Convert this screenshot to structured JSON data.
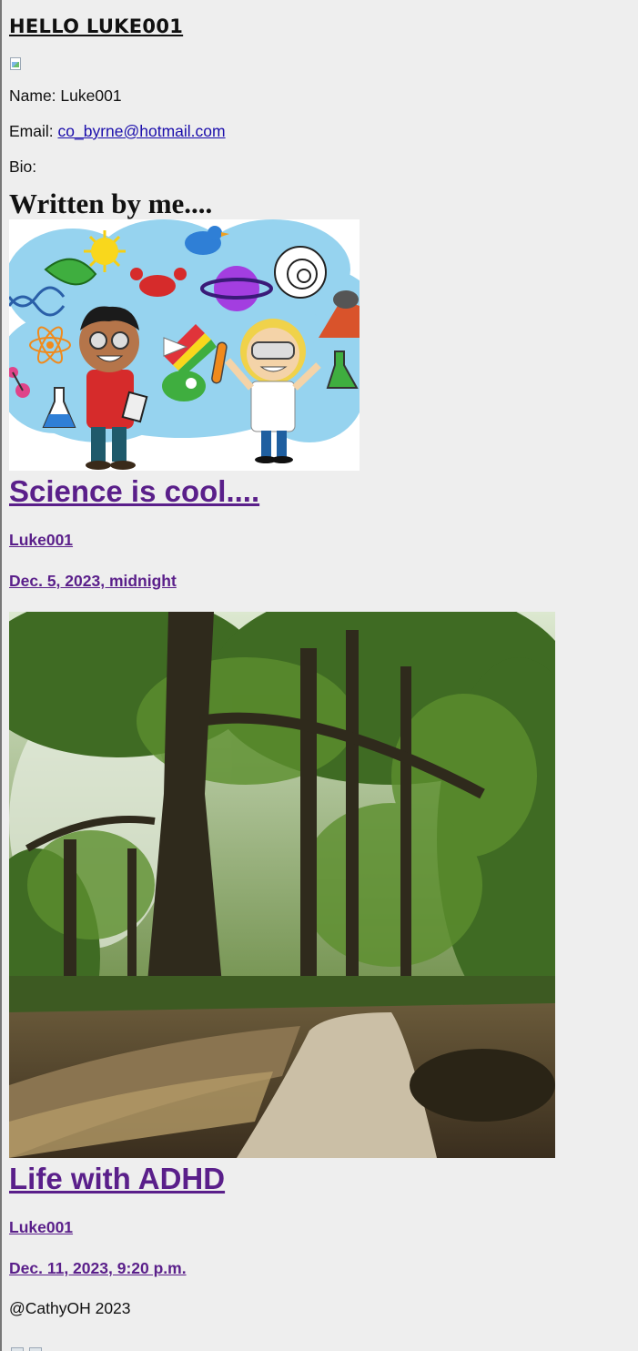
{
  "header": {
    "greeting": "HELLO LUKE001"
  },
  "profile": {
    "name_label": "Name:",
    "name_value": "Luke001",
    "email_label": "Email:",
    "email_value": "co_byrne@hotmail.com",
    "bio_label": "Bio:"
  },
  "section_title": "Written by me....",
  "posts": [
    {
      "image_icon": "science-illustration",
      "title": "Science is cool....",
      "author": "Luke001",
      "date": "Dec. 5, 2023, midnight"
    },
    {
      "image_icon": "forest-path-photo",
      "title": "Life with ADHD",
      "author": "Luke001",
      "date": "Dec. 11, 2023, 9:20 p.m."
    }
  ],
  "footer": {
    "copyright": "@CathyOH 2023"
  },
  "colors": {
    "background": "#eeeeee",
    "link_visited": "#5a1f8a",
    "link": "#1a0dab"
  }
}
